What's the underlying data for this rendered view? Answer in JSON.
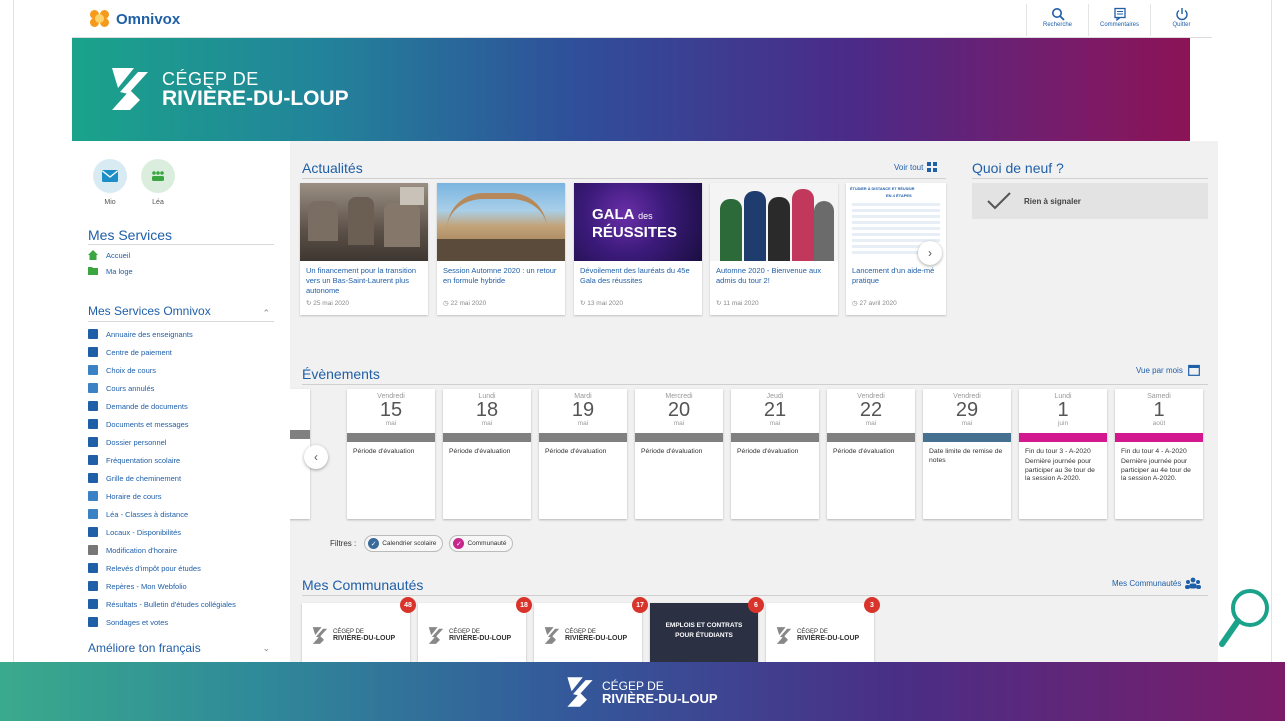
{
  "app": {
    "name": "Omnivox"
  },
  "topbar": {
    "search_label": "Recherche",
    "comments_label": "Commentaires",
    "quit_label": "Quitter"
  },
  "brand": {
    "line1": "CÉGEP DE",
    "line2": "RIVIÈRE-DU-LOUP"
  },
  "apps": [
    {
      "label": "Mio"
    },
    {
      "label": "Léa"
    }
  ],
  "services": {
    "title": "Mes Services",
    "items": [
      {
        "label": "Accueil"
      },
      {
        "label": "Ma loge"
      }
    ]
  },
  "omnivox_services": {
    "title": "Mes Services Omnivox",
    "items": [
      {
        "label": "Annuaire des enseignants"
      },
      {
        "label": "Centre de paiement"
      },
      {
        "label": "Choix de cours"
      },
      {
        "label": "Cours annulés"
      },
      {
        "label": "Demande de documents"
      },
      {
        "label": "Documents et messages"
      },
      {
        "label": "Dossier personnel"
      },
      {
        "label": "Fréquentation scolaire"
      },
      {
        "label": "Grille de cheminement"
      },
      {
        "label": "Horaire de cours"
      },
      {
        "label": "Léa - Classes à distance"
      },
      {
        "label": "Locaux - Disponibilités"
      },
      {
        "label": "Modification d'horaire"
      },
      {
        "label": "Relevés d'impôt pour études"
      },
      {
        "label": "Repères - Mon Webfolio"
      },
      {
        "label": "Résultats - Bulletin d'études collégiales"
      },
      {
        "label": "Sondages et votes"
      }
    ]
  },
  "french": {
    "title": "Améliore ton français"
  },
  "news": {
    "title": "Actualités",
    "see_all": "Voir tout",
    "items": [
      {
        "title": "Un financement pour la transition vers un Bas-Saint-Laurent plus autonome",
        "date": "25 mai 2020"
      },
      {
        "title": "Session Automne 2020 : un retour en formule hybride",
        "date": "22 mai 2020"
      },
      {
        "title": "Dévoilement des lauréats du 45e Gala des réussites",
        "date": "13 mai 2020",
        "img_text1": "GALA",
        "img_text2": "des",
        "img_text3": "RÉUSSITES"
      },
      {
        "title": "Automne 2020 - Bienvenue aux admis du tour 2!",
        "date": "11 mai 2020"
      },
      {
        "title": "Lancement d'un aide-mé pratique",
        "date": "27 avril 2020",
        "img_text1": "ÉTUDIER À DISTANCE ET RÉUSSIR",
        "img_text2": "EN 4 ÉTAPES"
      }
    ]
  },
  "whats_new": {
    "title": "Quoi de neuf ?",
    "message": "Rien à signaler"
  },
  "events": {
    "title": "Évènements",
    "view_by_month": "Vue par mois",
    "items": [
      {
        "day": "Vendredi",
        "num": "15",
        "month": "mai",
        "text": "Période d'évaluation",
        "color": "#808080"
      },
      {
        "day": "Lundi",
        "num": "18",
        "month": "mai",
        "text": "Période d'évaluation",
        "color": "#808080"
      },
      {
        "day": "Mardi",
        "num": "19",
        "month": "mai",
        "text": "Période d'évaluation",
        "color": "#808080"
      },
      {
        "day": "Mercredi",
        "num": "20",
        "month": "mai",
        "text": "Période d'évaluation",
        "color": "#808080"
      },
      {
        "day": "Jeudi",
        "num": "21",
        "month": "mai",
        "text": "Période d'évaluation",
        "color": "#808080"
      },
      {
        "day": "Vendredi",
        "num": "22",
        "month": "mai",
        "text": "Période d'évaluation",
        "color": "#808080"
      },
      {
        "day": "Vendredi",
        "num": "29",
        "month": "mai",
        "text": "Date limite de remise de notes",
        "color": "#46708f"
      },
      {
        "day": "Lundi",
        "num": "1",
        "month": "juin",
        "title": "Fin du tour 3 - A-2020",
        "text": "Dernière journée pour participer au 3e tour de la session A-2020.",
        "color": "#d3188f"
      },
      {
        "day": "Samedi",
        "num": "1",
        "month": "août",
        "title": "Fin du tour 4 - A-2020",
        "text": "Dernière journée pour participer au 4e tour de la session A-2020.",
        "color": "#d3188f"
      }
    ],
    "filters_label": "Filtres :",
    "filters": [
      {
        "label": "Calendrier scolaire",
        "color": "#3a6a9a"
      },
      {
        "label": "Communauté",
        "color": "#c7278c"
      }
    ]
  },
  "communities": {
    "title": "Mes Communautés",
    "link": "Mes Communautés",
    "items": [
      {
        "badge": "48",
        "line1": "CÉGEP DE",
        "line2": "RIVIÈRE-DU-LOUP"
      },
      {
        "badge": "18",
        "line1": "CÉGEP DE",
        "line2": "RIVIÈRE-DU-LOUP"
      },
      {
        "badge": "17",
        "line1": "CÉGEP DE",
        "line2": "RIVIÈRE-DU-LOUP"
      },
      {
        "badge": "6",
        "line1": "EMPLOIS ET CONTRATS",
        "line2": "POUR ÉTUDIANTS"
      },
      {
        "badge": "3",
        "line1": "CÉGEP DE",
        "line2": "RIVIÈRE-DU-LOUP"
      }
    ]
  },
  "colors": {
    "brand_blue": "#1f5fa8",
    "badge_red": "#d9342b",
    "accent_orange": "#f59a1b"
  }
}
